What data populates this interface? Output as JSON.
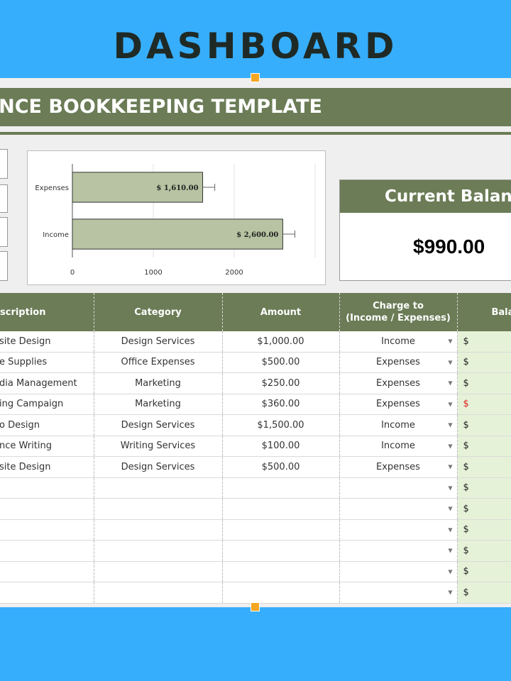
{
  "page": {
    "title": "DASHBOARD"
  },
  "sheet": {
    "banner": "LANCE BOOKKEEPING TEMPLATE"
  },
  "chart_data": {
    "type": "bar",
    "orientation": "horizontal",
    "categories": [
      "Expenses",
      "Income"
    ],
    "values": [
      1610,
      2600
    ],
    "data_labels": [
      "$ 1,610.00",
      "$ 2,600.00"
    ],
    "xlim": [
      0,
      3000
    ],
    "x_ticks": [
      0,
      1000,
      2000
    ],
    "error_bars": true,
    "grid": true,
    "bar_color": "#b7c3a2"
  },
  "balance": {
    "title": "Current Balance",
    "value": "$990.00"
  },
  "table": {
    "headers": {
      "description": "scription",
      "category": "Category",
      "amount": "Amount",
      "charge_line1": "Charge to",
      "charge_line2": "(Income / Expenses)",
      "balance": "Bala"
    },
    "rows": [
      {
        "description": "site Design",
        "category": "Design Services",
        "amount": "$1,000.00",
        "charge": "Income",
        "dollar": "$"
      },
      {
        "description": "e Supplies",
        "category": "Office Expenses",
        "amount": "$500.00",
        "charge": "Expenses",
        "dollar": "$"
      },
      {
        "description": "dia Management",
        "category": "Marketing",
        "amount": "$250.00",
        "charge": "Expenses",
        "dollar": "$"
      },
      {
        "description": "ing Campaign",
        "category": "Marketing",
        "amount": "$360.00",
        "charge": "Expenses",
        "dollar": "$"
      },
      {
        "description": "o Design",
        "category": "Design Services",
        "amount": "$1,500.00",
        "charge": "Income",
        "dollar": "$"
      },
      {
        "description": "nce Writing",
        "category": "Writing Services",
        "amount": "$100.00",
        "charge": "Income",
        "dollar": "$"
      },
      {
        "description": "site Design",
        "category": "Design Services",
        "amount": "$500.00",
        "charge": "Expenses",
        "dollar": "$"
      },
      {
        "description": "",
        "category": "",
        "amount": "",
        "charge": "",
        "dollar": "$"
      },
      {
        "description": "",
        "category": "",
        "amount": "",
        "charge": "",
        "dollar": "$"
      },
      {
        "description": "",
        "category": "",
        "amount": "",
        "charge": "",
        "dollar": "$"
      },
      {
        "description": "",
        "category": "",
        "amount": "",
        "charge": "",
        "dollar": "$"
      },
      {
        "description": "",
        "category": "",
        "amount": "",
        "charge": "",
        "dollar": "$"
      },
      {
        "description": "",
        "category": "",
        "amount": "",
        "charge": "",
        "dollar": "$"
      }
    ],
    "negative_row_index": 3,
    "dropdown_arrow": "▼",
    "colors": {
      "header": "#6b7c56",
      "balance_bg": "#e6f2d8",
      "negative": "#e02020"
    }
  }
}
